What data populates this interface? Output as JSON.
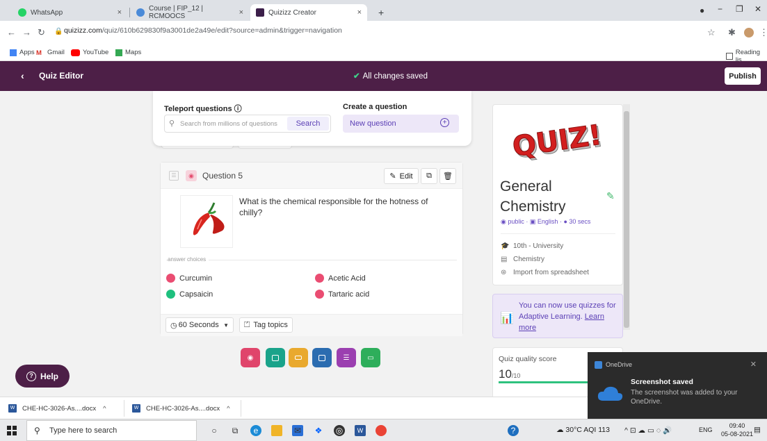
{
  "browser": {
    "tabs": [
      {
        "title": "WhatsApp",
        "close": "×",
        "color": "#25d366"
      },
      {
        "title": "Course | FIP_12 | RCMOOCS",
        "close": "×",
        "color": "#4a8ad8"
      },
      {
        "title": "Quizizz Creator",
        "close": "×",
        "color": "#3c1f4a"
      }
    ],
    "new_tab": "+",
    "url_host": "quizizz.com",
    "url_path": "/quiz/610b629830f9a3001de2a49e/edit?source=admin&trigger=navigation",
    "bookmarks": [
      {
        "label": "Apps",
        "icon": "apps-grid-icon"
      },
      {
        "label": "Gmail",
        "icon": "gmail-icon"
      },
      {
        "label": "YouTube",
        "icon": "youtube-icon"
      },
      {
        "label": "Maps",
        "icon": "maps-icon"
      }
    ],
    "reading_list": "Reading lis"
  },
  "header": {
    "title": "Quiz Editor",
    "saved_status": "All changes saved",
    "publish_label": "Publish"
  },
  "topcard": {
    "teleport_label": "Teleport questions",
    "search_placeholder": "Search from millions of questions",
    "search_button": "Search",
    "create_label": "Create a question",
    "new_question": "New question"
  },
  "question": {
    "number_label": "Question 5",
    "edit_label": "Edit",
    "text": "What is the chemical responsible for the hotness of chilly?",
    "answer_choices_label": "answer choices",
    "choices": [
      {
        "label": "Curcumin",
        "correct": false
      },
      {
        "label": "Acetic Acid",
        "correct": false
      },
      {
        "label": "Capsaicin",
        "correct": true
      },
      {
        "label": "Tartaric acid",
        "correct": false
      }
    ],
    "time_label": "60 Seconds",
    "tag_label": "Tag topics"
  },
  "question_types": [
    {
      "icon": "multiple-choice-icon",
      "color": "#e0456b"
    },
    {
      "icon": "checkbox-icon",
      "color": "#1aa38a"
    },
    {
      "icon": "fill-blank-icon",
      "color": "#e9a92e"
    },
    {
      "icon": "open-ended-icon",
      "color": "#2b6cb0"
    },
    {
      "icon": "poll-icon",
      "color": "#9b3fb0"
    },
    {
      "icon": "slide-icon",
      "color": "#2eae5b"
    }
  ],
  "quiz_panel": {
    "image_text": "QUIZ!",
    "title": "General Chemistry",
    "visibility": "public",
    "language": "English",
    "duration": "30 secs",
    "grade": "10th - University",
    "subject": "Chemistry",
    "import_label": "Import from spreadsheet",
    "adaptive_text": "You can now use quizzes for Adaptive Learning.",
    "learn_more": "Learn more",
    "quality_label": "Quiz quality score",
    "quality_value": "10",
    "quality_max": "/10"
  },
  "help_label": "Help",
  "toast": {
    "app": "OneDrive",
    "title": "Screenshot saved",
    "body": "The screenshot was added to your OneDrive."
  },
  "downloads": [
    {
      "name": "CHE-HC-3026-As....docx"
    },
    {
      "name": "CHE-HC-3026-As....docx"
    }
  ],
  "taskbar": {
    "search_placeholder": "Type here to search",
    "weather": "30°C  AQI 113",
    "lang": "ENG",
    "time": "09:40",
    "date": "05-08-2021"
  }
}
